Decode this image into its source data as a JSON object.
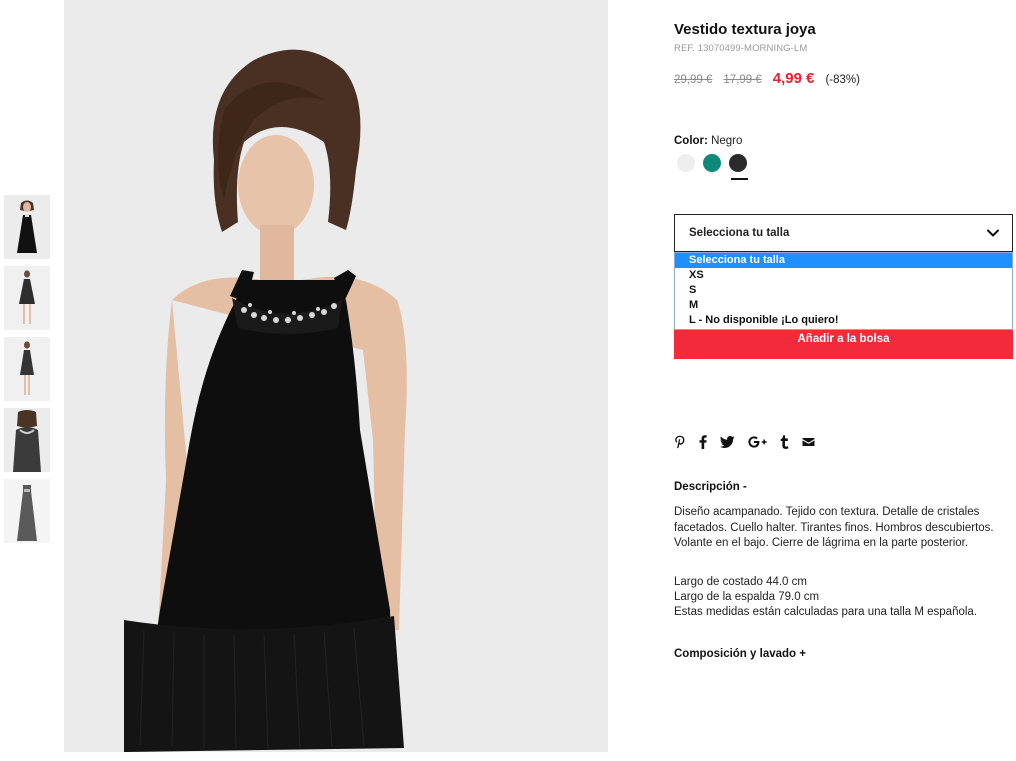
{
  "product": {
    "title": "Vestido textura joya",
    "ref": "REF. 13070499-MORNING-LM",
    "price_original": "29,99 €",
    "price_previous": "17,99 €",
    "price_current": "4,99 €",
    "discount": "(-83%)"
  },
  "color": {
    "label": "Color:",
    "selected": "Negro",
    "swatches": [
      {
        "name": "white",
        "hex": "#eeeeee"
      },
      {
        "name": "teal",
        "hex": "#0f8a7a"
      },
      {
        "name": "black",
        "hex": "#2b2b2b"
      }
    ]
  },
  "size": {
    "selected": "Selecciona tu talla",
    "options": [
      "Selecciona tu talla",
      "XS",
      "S",
      "M",
      "L - No disponible ¡Lo quiero!"
    ]
  },
  "actions": {
    "add_to_bag": "Añadir a la bolsa"
  },
  "share": {
    "icons": [
      "pinterest-icon",
      "facebook-icon",
      "twitter-icon",
      "google-plus-icon",
      "tumblr-icon",
      "email-icon"
    ]
  },
  "description": {
    "title": "Descripción -",
    "text": "Diseño acampanado. Tejido con textura. Detalle de cristales facetados. Cuello halter. Tirantes finos. Hombros descubiertos. Volante en el bajo. Cierre de lágrima en la parte posterior.",
    "measure_1": "Largo de costado 44.0 cm",
    "measure_2": "Largo de la espalda 79.0 cm",
    "measure_note": "Estas medidas están calculadas para una talla M española."
  },
  "composition": {
    "title": "Composición y lavado +"
  },
  "colors": {
    "accent_red": "#f32a3b",
    "price_red": "#e8202f",
    "dropdown_highlight": "#1e90ff"
  }
}
